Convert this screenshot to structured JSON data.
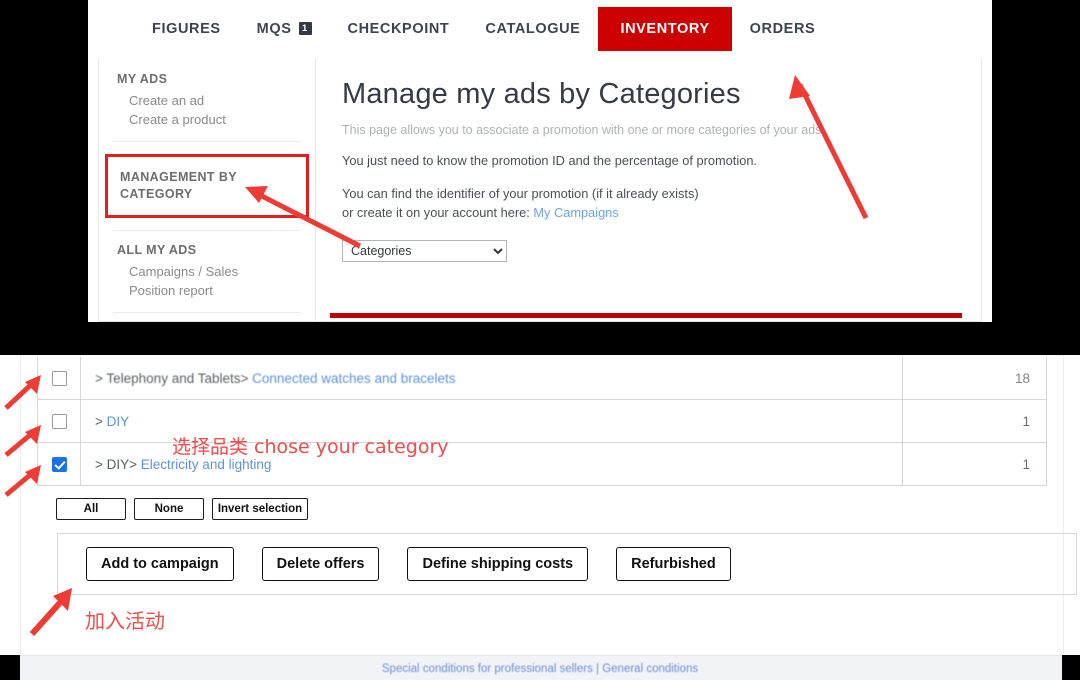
{
  "nav": {
    "items": [
      {
        "label": "FIGURES",
        "active": false,
        "badge": null
      },
      {
        "label": "MQS",
        "active": false,
        "badge": "1"
      },
      {
        "label": "CHECKPOINT",
        "active": false,
        "badge": null
      },
      {
        "label": "CATALOGUE",
        "active": false,
        "badge": null
      },
      {
        "label": "INVENTORY",
        "active": true,
        "badge": null
      },
      {
        "label": "ORDERS",
        "active": false,
        "badge": null
      }
    ],
    "active_color": "#cc0000"
  },
  "sidebar": {
    "groups": [
      {
        "heading": "MY ADS",
        "links": [
          "Create an ad",
          "Create a product"
        ]
      },
      {
        "heading_line1": "MANAGEMENT BY",
        "heading_line2": "CATEGORY",
        "highlighted": true,
        "highlight_color": "#e02020"
      },
      {
        "heading": "ALL MY ADS",
        "links": [
          "Campaigns / Sales",
          "Position report"
        ]
      }
    ]
  },
  "main": {
    "title": "Manage my ads by Categories",
    "lead": "This page allows you to associate a promotion with one or more categories of your ads.",
    "para1": "You just need to know the promotion ID and the percentage of promotion.",
    "para2_line1": "You can find the identifier of your promotion (if it already exists)",
    "para2_line2_prefix": "or create it on your account here: ",
    "para2_link": "My Campaigns",
    "select": {
      "selected": "Categories",
      "options": [
        "Categories"
      ]
    }
  },
  "table": {
    "rows": [
      {
        "checked": false,
        "blurred": true,
        "crumb": "> Telephony and Tablets>",
        "link": "Connected watches and bracelets",
        "count": "18"
      },
      {
        "checked": false,
        "blurred": false,
        "crumb": ">",
        "link": "DIY",
        "count": "1"
      },
      {
        "checked": true,
        "blurred": false,
        "crumb": "> DIY>",
        "link": "Electricity and lighting",
        "count": "1"
      }
    ]
  },
  "selection_buttons": [
    {
      "label": "All"
    },
    {
      "label": "None"
    },
    {
      "label": "Invert selection"
    }
  ],
  "action_buttons": [
    {
      "label": "Add to campaign"
    },
    {
      "label": "Delete offers"
    },
    {
      "label": "Define shipping costs"
    },
    {
      "label": "Refurbished"
    }
  ],
  "footer": {
    "links_text": "Special conditions for professional sellers | General conditions"
  },
  "annotations": {
    "middle_note": "选择品类 chose your category",
    "bottom_note": "加入活动",
    "arrow_color": "#ee3b33"
  }
}
